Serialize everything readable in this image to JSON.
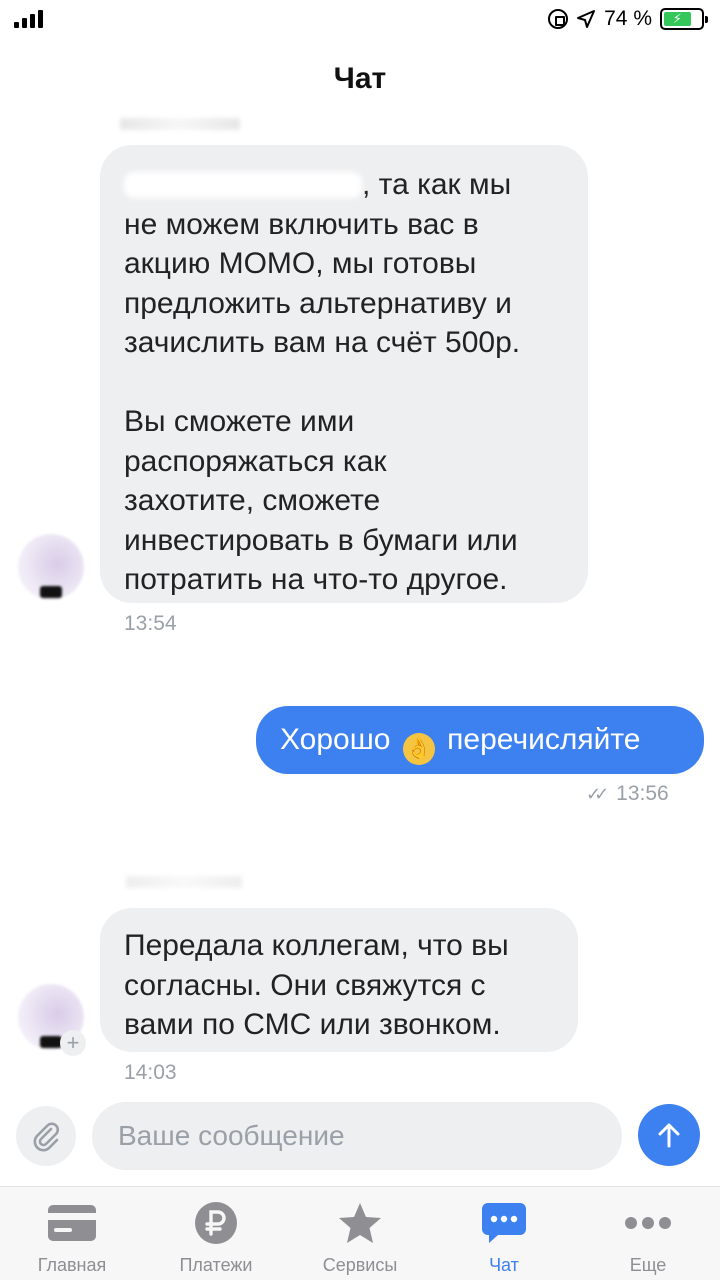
{
  "status_bar": {
    "carrier": "",
    "battery_percent": "74 %",
    "battery_level": 0.74
  },
  "header": {
    "title": "Чат"
  },
  "messages": [
    {
      "direction": "incoming",
      "text": ", та как мы\nне можем включить вас в\nакцию МОМО, мы готовы\nпредложить альтернативу и\nзачислить вам на счёт 500р.\n\nВы сможете ими\nраспоряжаться как\nзахотите, сможете\nинвестировать в бумаги или\nпотратить на что-то другое.",
      "time": "13:54"
    },
    {
      "direction": "outgoing",
      "text_before": "Хорошо",
      "emoji": "ok-hand-emoji",
      "text_after": "перечисляйте",
      "time": "13:56",
      "status": "read"
    },
    {
      "direction": "incoming",
      "text": "Передала коллегам, что вы\nсогласны. Они свяжутся с\nвами по СМС или звонком.",
      "time": "14:03"
    }
  ],
  "composer": {
    "placeholder": "Ваше сообщение",
    "value": ""
  },
  "tabs": [
    {
      "label": "Главная",
      "icon": "card-icon",
      "active": false
    },
    {
      "label": "Платежи",
      "icon": "ruble-icon",
      "active": false
    },
    {
      "label": "Сервисы",
      "icon": "star-icon",
      "active": false
    },
    {
      "label": "Чат",
      "icon": "chat-bubble-icon",
      "active": true
    },
    {
      "label": "Еще",
      "icon": "more-dots-icon",
      "active": false
    }
  ],
  "colors": {
    "accent": "#3d80f0",
    "incoming_bubble": "#eeeff1",
    "muted": "#9aa0a8",
    "battery": "#34c759"
  }
}
